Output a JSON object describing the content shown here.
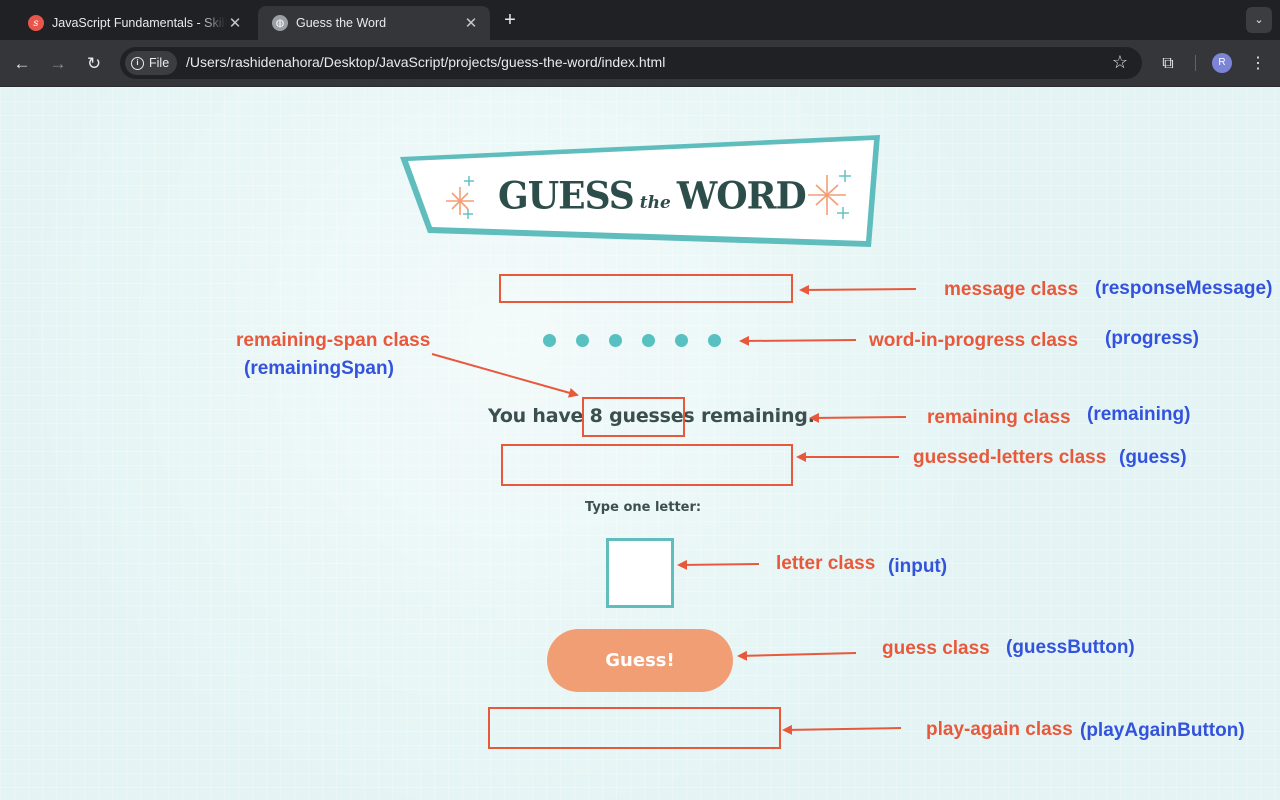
{
  "browser": {
    "tabs": [
      {
        "title": "JavaScript Fundamentals - Skillcrush",
        "favicon": "skillcrush-icon",
        "active": false
      },
      {
        "title": "Guess the Word",
        "favicon": "globe-icon",
        "active": true
      }
    ],
    "address_chip": "File",
    "url": "/Users/rashidenahora/Desktop/JavaScript/projects/guess-the-word/index.html",
    "profile_initial": "R"
  },
  "page": {
    "logo": {
      "word1": "GUESS",
      "the": "the",
      "word2": "WORD"
    },
    "word_in_progress_dots": 6,
    "remaining": {
      "prefix": "You have ",
      "span": "8 guesses",
      "suffix": " remaining."
    },
    "letter_prompt": "Type one letter:",
    "letter_value": "",
    "guess_button": "Guess!"
  },
  "annotations": {
    "remaining_span": {
      "class_label": "remaining-span class",
      "var_label": "(remainingSpan)"
    },
    "message": {
      "class_label": "message class",
      "var_label": "(responseMessage)"
    },
    "word_in_progress": {
      "class_label": "word-in-progress class",
      "var_label": "(progress)"
    },
    "remaining": {
      "class_label": "remaining class",
      "var_label": "(remaining)"
    },
    "guessed_letters": {
      "class_label": "guessed-letters class",
      "var_label": "(guess)"
    },
    "letter": {
      "class_label": "letter class",
      "var_label": "(input)"
    },
    "guess": {
      "class_label": "guess class",
      "var_label": "(guessButton)"
    },
    "play_again": {
      "class_label": "play-again class",
      "var_label": "(playAgainButton)"
    }
  },
  "colors": {
    "annotation_red": "#e8593b",
    "annotation_blue": "#3353dd",
    "teal": "#57c1c1",
    "button_orange": "#f29e75",
    "page_bg": "#e4f4f4"
  }
}
